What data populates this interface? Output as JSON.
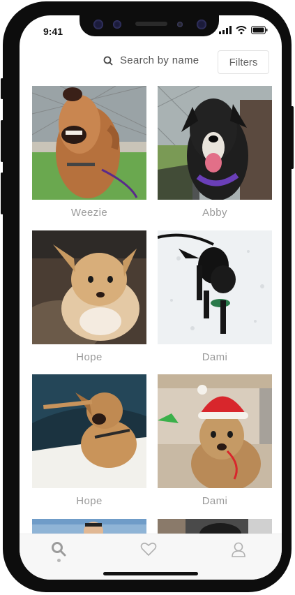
{
  "status_bar": {
    "time": "9:41"
  },
  "search": {
    "placeholder": "Search by name"
  },
  "filters": {
    "label": "Filters"
  },
  "dogs": [
    {
      "name": "Weezie"
    },
    {
      "name": "Abby"
    },
    {
      "name": "Hope"
    },
    {
      "name": "Dami"
    },
    {
      "name": "Hope"
    },
    {
      "name": "Dami"
    }
  ],
  "tabbar": {
    "items": [
      {
        "icon": "search-icon",
        "active": true
      },
      {
        "icon": "heart-icon",
        "active": false
      },
      {
        "icon": "profile-icon",
        "active": false
      }
    ]
  },
  "colors": {
    "text_muted": "#9a9a9a",
    "tabbar_bg": "#f7f7f7"
  }
}
